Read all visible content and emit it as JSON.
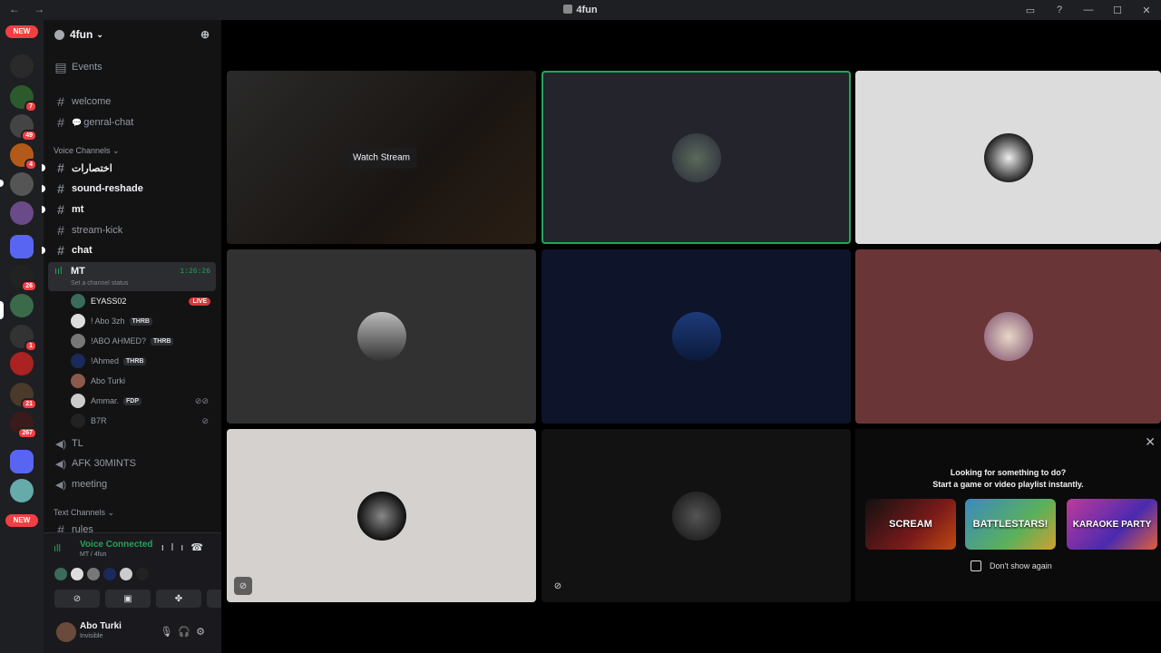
{
  "window": {
    "title": "4fun",
    "nav": "← →",
    "controls": [
      "▭",
      "?",
      "—",
      "☐",
      "✕"
    ]
  },
  "server_rail": {
    "new_top": "NEW",
    "new_bottom": "NEW",
    "badges": [
      "7",
      "49",
      "4",
      "26",
      "1",
      "21",
      "267"
    ]
  },
  "guild": {
    "name": "4fun",
    "chevron": "⌄",
    "invite_icon": "person-add-icon"
  },
  "channels": {
    "events": "Events",
    "welcome": "welcome",
    "genral_chat": "genral-chat",
    "voice_category": "Voice Channels",
    "ch_arabic": "اختصارات",
    "sound_reshade": "sound-reshade",
    "mt_text": "mt",
    "stream_kick": "stream-kick",
    "chat": "chat",
    "active_voice": {
      "name": "MT",
      "timer": "1:26:26",
      "status": "Set a channel status"
    },
    "tl": "TL",
    "afk": "AFK 30MINTS",
    "meeting": "meeting",
    "text_category": "Text Channels",
    "rules": "rules"
  },
  "voice_users": [
    {
      "name": "EYASS02",
      "tag": "",
      "live": "LIVE"
    },
    {
      "name": "! Abo 3zh",
      "tag": "THRB"
    },
    {
      "name": "!ABO AHMED?",
      "tag": "THRB"
    },
    {
      "name": "!Ahmed",
      "tag": "THRB"
    },
    {
      "name": "Abo Turki",
      "tag": ""
    },
    {
      "name": "Ammar.",
      "tag": "FDP"
    },
    {
      "name": "B7R",
      "tag": ""
    }
  ],
  "voice_panel": {
    "title": "Voice Connected",
    "sub": "MT / 4fun"
  },
  "user_panel": {
    "name": "Abo Turki",
    "status": "Invisible"
  },
  "stage": {
    "watch_stream": "Watch Stream"
  },
  "promo": {
    "line1": "Looking for something to do?",
    "line2": "Start a game or video playlist instantly.",
    "games": [
      "SCREAM",
      "BATTLESTARS!",
      "KARAOKE PARTY"
    ],
    "checkbox": "Don't show again",
    "close": "✕"
  },
  "colors": {
    "speaking": "#23a55a",
    "live": "#da373c",
    "badge": "#f23f43"
  }
}
